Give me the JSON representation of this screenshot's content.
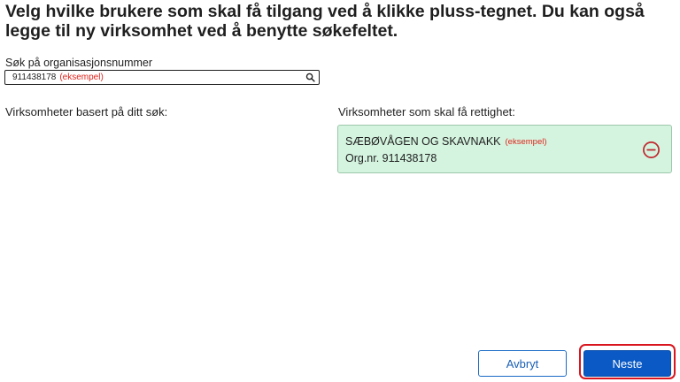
{
  "heading": "Velg hvilke brukere som skal få tilgang ved å klikke pluss-tegnet. Du kan også legge til ny virksomhet ved å benytte søkefeltet.",
  "search": {
    "label": "Søk på organisasjonsnummer",
    "value": "911438178",
    "example_tag": "(eksempel)",
    "icon": "search-icon"
  },
  "columns": {
    "left_heading": "Virksomheter basert på ditt søk:",
    "right_heading": "Virksomheter som skal få rettighet:"
  },
  "selected": [
    {
      "name": "SÆBØVÅGEN OG SKAVNAKK",
      "example_tag": "(eksempel)",
      "org_nr": "Org.nr. 911438178",
      "icon": "minus-circle-icon"
    }
  ],
  "actions": {
    "cancel_label": "Avbryt",
    "next_label": "Neste"
  },
  "colors": {
    "example_red": "#e0241c",
    "selected_bg": "#d4f4df",
    "primary_blue": "#0a59c4",
    "highlight_red": "#d9161f",
    "remove_icon": "#c0262d"
  }
}
